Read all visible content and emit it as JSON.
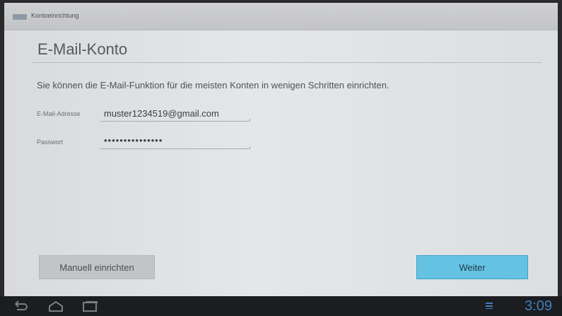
{
  "titlebar": {
    "title": "Kontoeinrichtung",
    "icon": "app-account-icon"
  },
  "page": {
    "title": "E-Mail-Konto",
    "intro": "Sie können die E-Mail-Funktion für die meisten Konten in wenigen Schritten einrichten."
  },
  "form": {
    "email": {
      "label": "E-Mail-Adresse",
      "value": "muster1234519@gmail.com"
    },
    "password": {
      "label": "Passwort",
      "value": "•••••••••••••••"
    }
  },
  "buttons": {
    "manual": "Manuell einrichten",
    "next": "Weiter"
  },
  "navbar": {
    "icons": [
      "back-icon",
      "home-icon",
      "recent-apps-icon"
    ],
    "clock": "3:09"
  },
  "colors": {
    "accent": "#64c3e2",
    "clock": "#3f7fbf",
    "background": "#dcdee0"
  }
}
